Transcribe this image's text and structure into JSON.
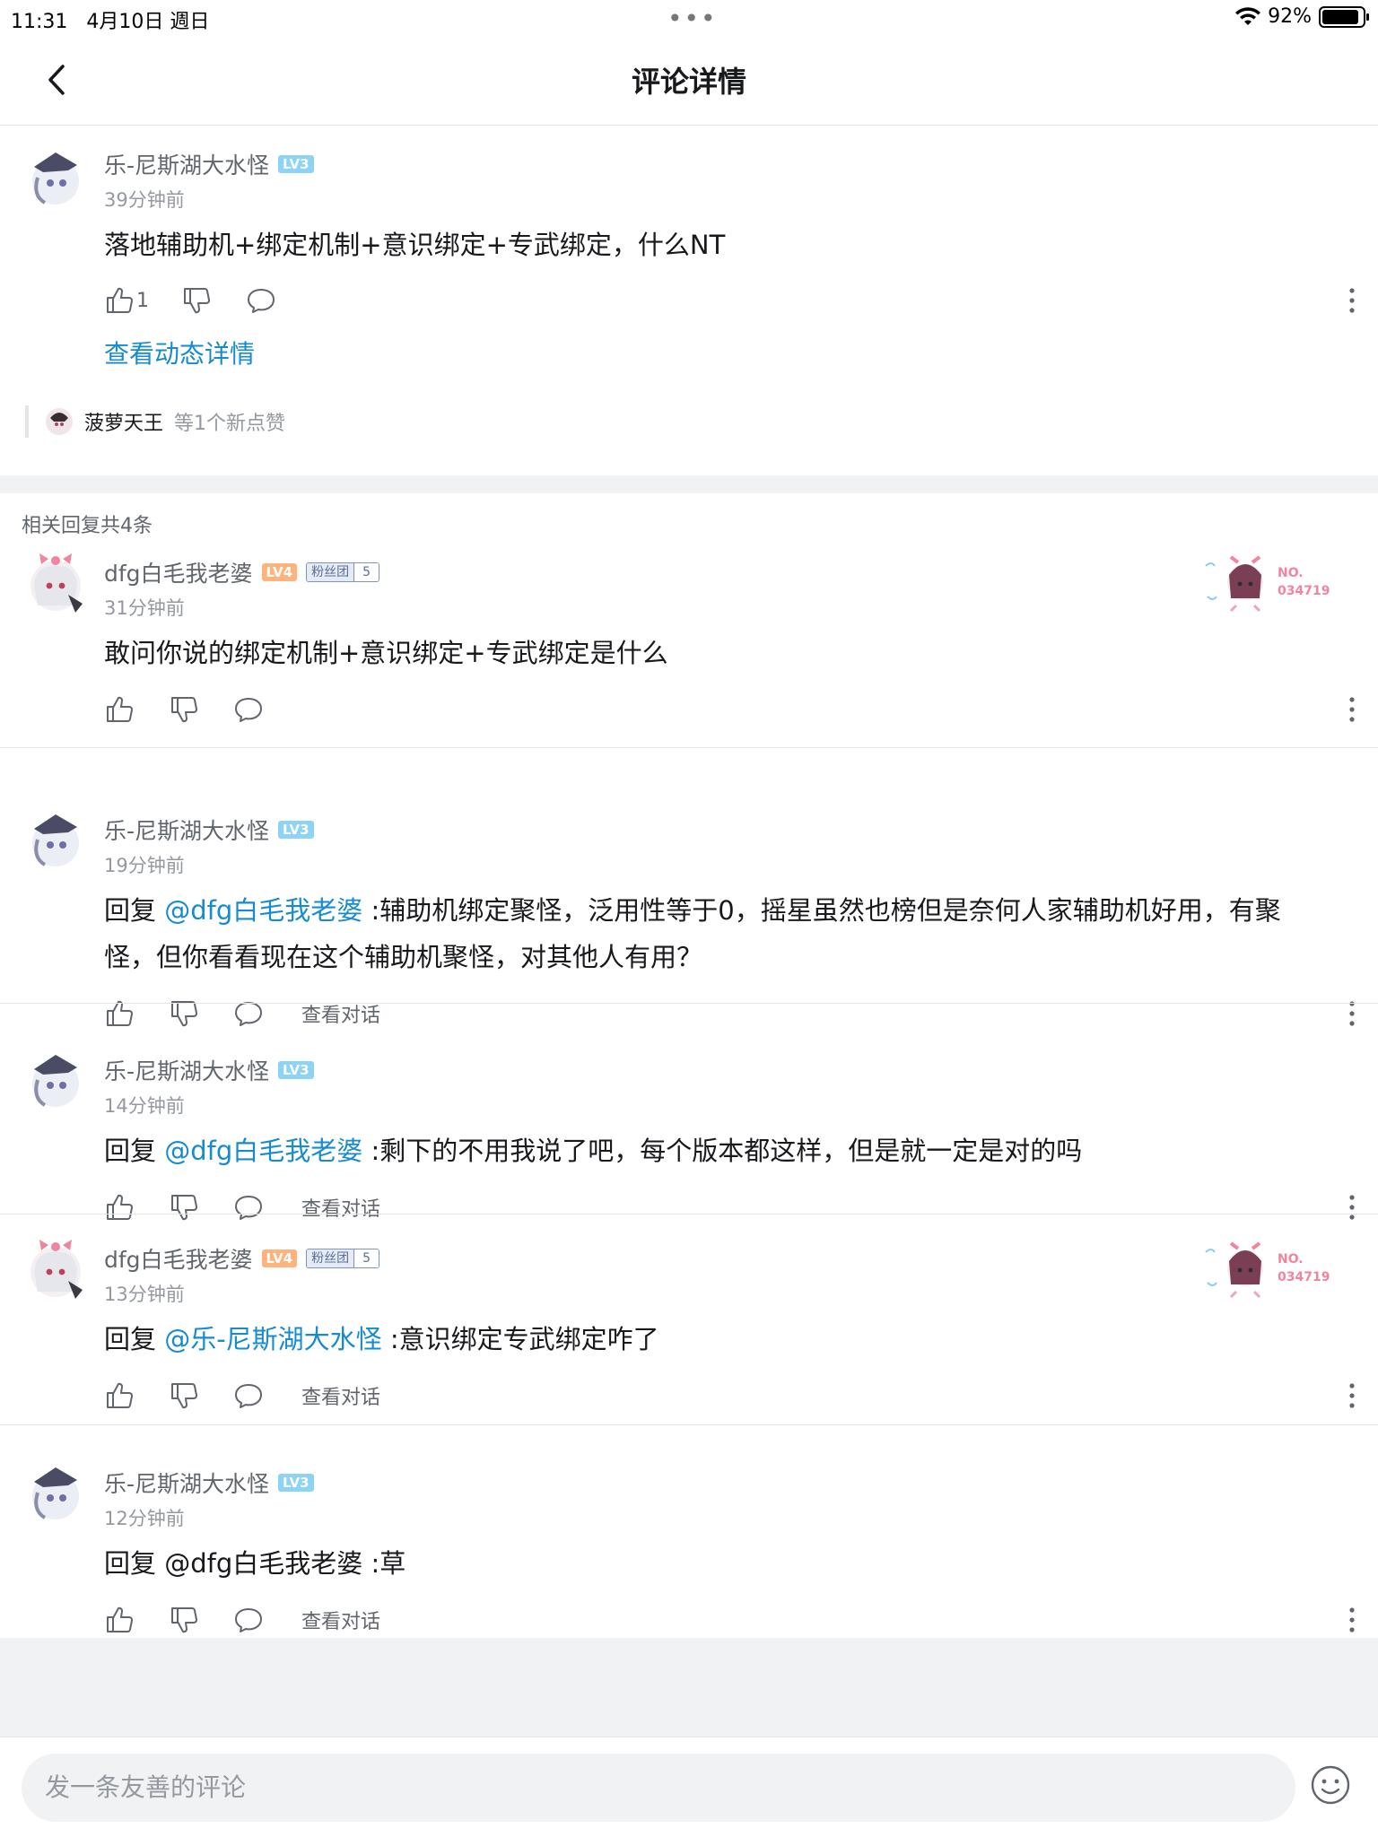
{
  "status": {
    "time": "11:31",
    "date": "4月10日 週日",
    "dots": "•••",
    "battery_pct_text": "92%",
    "battery_level": 0.92
  },
  "nav": {
    "title": "评论详情"
  },
  "root": {
    "user": "乐-尼斯湖大水怪",
    "level": "LV3",
    "time": "39分钟前",
    "text": "落地辅助机+绑定机制+意识绑定+专武绑定，什么NT",
    "likes": "1",
    "detail_link": "查看动态详情",
    "liker_name": "菠萝天王",
    "liker_rest": "等1个新点赞"
  },
  "reply_count": "相关回复共4条",
  "replies": [
    {
      "user": "dfg白毛我老婆",
      "level": "LV4",
      "fans_name": "粉丝团",
      "fans_level": "5",
      "badge_no": "NO.",
      "badge_id": "034719",
      "time": "31分钟前",
      "prefix": "",
      "mention": "",
      "text": "敢问你说的绑定机制+意识绑定+专武绑定是什么",
      "dialog": ""
    },
    {
      "user": "乐-尼斯湖大水怪",
      "level": "LV3",
      "time": "19分钟前",
      "prefix": "回复 ",
      "mention": "@dfg白毛我老婆",
      "text": " :辅助机绑定聚怪，泛用性等于0，摇星虽然也榜但是奈何人家辅助机好用，有聚怪，但你看看现在这个辅助机聚怪，对其他人有用？",
      "dialog": "查看对话"
    },
    {
      "user": "乐-尼斯湖大水怪",
      "level": "LV3",
      "time": "14分钟前",
      "prefix": "回复 ",
      "mention": "@dfg白毛我老婆",
      "text": " :剩下的不用我说了吧，每个版本都这样，但是就一定是对的吗",
      "dialog": "查看对话"
    },
    {
      "user": "dfg白毛我老婆",
      "level": "LV4",
      "fans_name": "粉丝团",
      "fans_level": "5",
      "badge_no": "NO.",
      "badge_id": "034719",
      "time": "13分钟前",
      "prefix": "回复 ",
      "mention": "@乐-尼斯湖大水怪",
      "text": " :意识绑定专武绑定咋了",
      "dialog": "查看对话"
    },
    {
      "user": "乐-尼斯湖大水怪",
      "level": "LV3",
      "time": "12分钟前",
      "prefix": "回复 @dfg白毛我老婆 :草",
      "mention": "",
      "text": "",
      "dialog": "查看对话"
    }
  ],
  "input": {
    "placeholder": "发一条友善的评论"
  },
  "icons": {
    "back": "chevron-left-icon",
    "like": "thumb-up-icon",
    "dislike": "thumb-down-icon",
    "reply": "comment-bubble-icon",
    "more": "more-vertical-icon",
    "emoji": "emoji-icon",
    "wifi": "wifi-icon",
    "battery": "battery-icon"
  },
  "colors": {
    "link": "#178bcf",
    "lv3": "#8cd3f5",
    "lv4": "#ffb37c",
    "band": "#f1f2f3"
  }
}
